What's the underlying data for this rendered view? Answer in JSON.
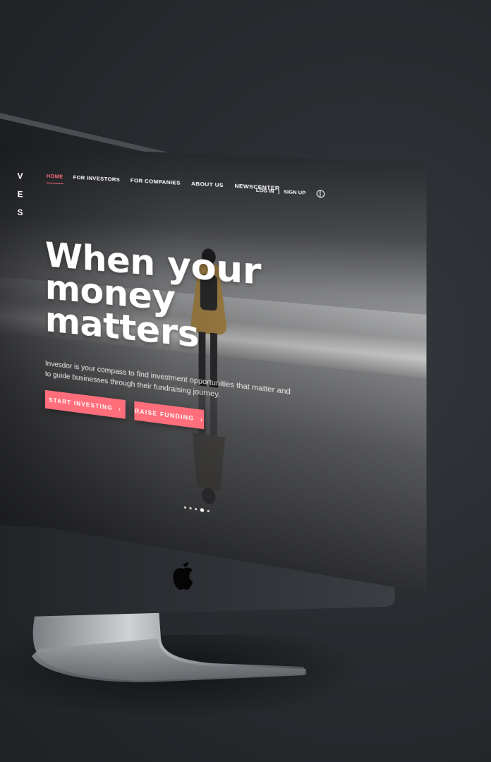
{
  "brand": {
    "logo_letters": "VES",
    "accent_color": "#ff6e7a"
  },
  "nav": {
    "items": [
      {
        "label": "HOME",
        "active": true
      },
      {
        "label": "FOR INVESTORS",
        "active": false
      },
      {
        "label": "FOR COMPANIES",
        "active": false
      },
      {
        "label": "ABOUT US",
        "active": false
      },
      {
        "label": "NEWSCENTER",
        "active": false
      }
    ],
    "login_label": "LOG IN",
    "separator": "|",
    "signup_label": "SIGN UP",
    "language_icon": "globe-icon"
  },
  "hero": {
    "title": "When your money matters",
    "subtitle": "Invesdor is your compass to find investment opportunities that matter and to guide businesses through their fundraising journey.",
    "primary_button": "START INVESTING",
    "secondary_button": "RAISE FUNDING",
    "button_arrow": "›"
  },
  "carousel": {
    "slide_count": 5,
    "active_slide": 4
  },
  "device": {
    "logo_icon": "apple-icon"
  }
}
